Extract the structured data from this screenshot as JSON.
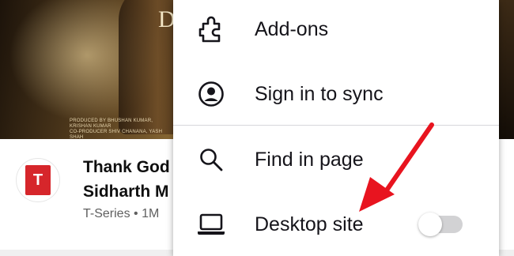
{
  "background": {
    "thumbnail_letter": "D",
    "credits": [
      "PRODUCED BY BHUSHAN KUMAR, KRISHAN KUMAR",
      "CO-PRODUCER SHIV CHANANA, YASH SHAH"
    ],
    "video_title_line1": "Thank God",
    "video_title_line2": "Sidharth M",
    "video_meta": "T-Series • 1M",
    "channel_avatar_text": "T"
  },
  "menu": {
    "items": [
      {
        "label": "Add-ons",
        "icon": "puzzle-piece-icon"
      },
      {
        "label": "Sign in to sync",
        "icon": "account-icon"
      },
      {
        "label": "Find in page",
        "icon": "search-icon"
      },
      {
        "label": "Desktop site",
        "icon": "laptop-icon"
      }
    ],
    "desktop_site_toggle": false
  },
  "annotation": {
    "arrow_color": "#e8141f"
  }
}
